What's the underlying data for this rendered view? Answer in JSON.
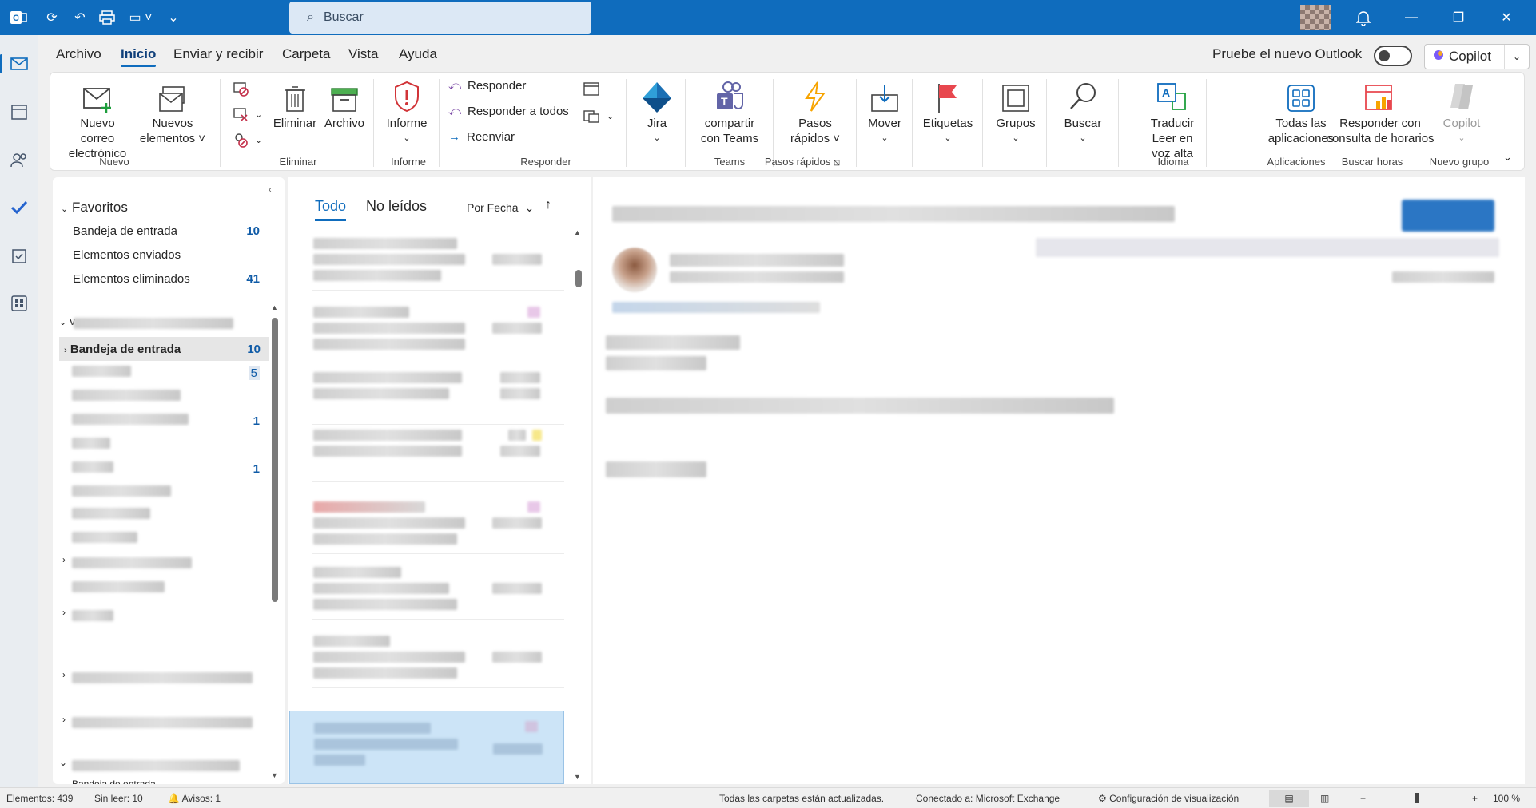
{
  "titlebar": {
    "search_placeholder": "Buscar"
  },
  "menu": {
    "items": [
      "Archivo",
      "Inicio",
      "Enviar y recibir",
      "Carpeta",
      "Vista",
      "Ayuda"
    ],
    "try_new_outlook": "Pruebe el nuevo Outlook",
    "copilot": "Copilot"
  },
  "ribbon": {
    "new_email": [
      "Nuevo correo",
      "electrónico"
    ],
    "new_items": [
      "Nuevos",
      "elementos ˅"
    ],
    "group_new": "Nuevo",
    "delete": "Eliminar",
    "archive": "Archivo",
    "group_delete": "Eliminar",
    "report": "Informe",
    "group_report": "Informe",
    "reply": "Responder",
    "reply_all": "Responder a todos",
    "forward": "Reenviar",
    "group_respond": "Responder",
    "jira": "Jira",
    "teams": [
      "compartir",
      "con Teams"
    ],
    "group_teams": "Teams",
    "quick_steps": [
      "Pasos",
      "rápidos ˅"
    ],
    "group_quick_steps": "Pasos rápidos",
    "move": "Mover",
    "tags": "Etiquetas",
    "groups": "Grupos",
    "find": "Buscar",
    "translate": [
      "Traducir",
      "Leer en voz alta"
    ],
    "group_language": "Idioma",
    "all_apps": [
      "Todas las",
      "aplicaciones"
    ],
    "group_apps": "Aplicaciones",
    "scheduling": [
      "Responder con",
      "consulta de horarios"
    ],
    "group_find_times": "Buscar horas",
    "copilot_btn": "Copilot",
    "group_new_group": "Nuevo grupo"
  },
  "folders": {
    "favorites_title": "Favoritos",
    "favorites": [
      {
        "label": "Bandeja de entrada",
        "count": "10"
      },
      {
        "label": "Elementos enviados",
        "count": ""
      },
      {
        "label": "Elementos eliminados",
        "count": "41"
      }
    ],
    "account_inbox": {
      "label": "Bandeja de entrada",
      "count": "10"
    },
    "account_counts": [
      "5",
      "1",
      "1"
    ],
    "bottom_partial": "Bandeja de entrada"
  },
  "list": {
    "tab_all": "Todo",
    "tab_unread": "No leídos",
    "sort": "Por Fecha"
  },
  "status": {
    "items": "Elementos: 439",
    "unread": "Sin leer: 10",
    "reminders": "Avisos: 1",
    "folders_updated": "Todas las carpetas están actualizadas.",
    "connected": "Conectado a: Microsoft Exchange",
    "display_settings": "Configuración de visualización",
    "zoom": "100 %"
  },
  "colors": {
    "accent": "#0f6cbd",
    "selected_mail": "#cce4f7",
    "count_blue": "#0f5ba7"
  }
}
